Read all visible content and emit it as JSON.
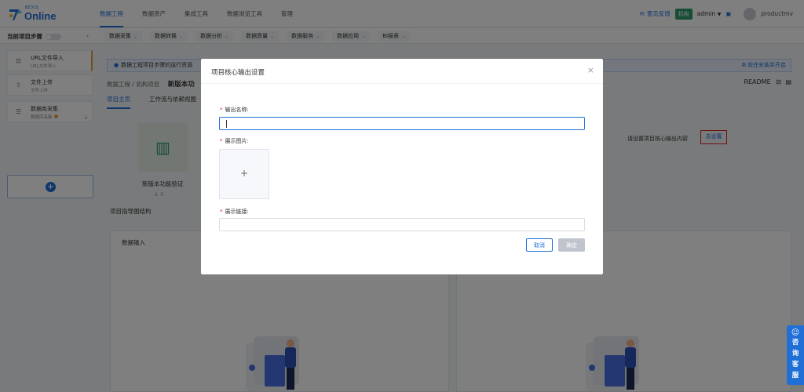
{
  "brand": {
    "small": "BEXIS",
    "name": "Online"
  },
  "nav": [
    "数据工程",
    "数据资产",
    "集成工具",
    "数据浏览工具",
    "管理"
  ],
  "topright": {
    "feedback": "意见反馈",
    "org_tag": "机构",
    "user": "admin",
    "account": "productmv"
  },
  "subbar": {
    "current_step": "当前项目步骤"
  },
  "subnav": [
    "数据采集",
    "数据转换",
    "数据分析",
    "数据质量",
    "数据服务",
    "数据应用",
    "BI报表"
  ],
  "sidebar": [
    {
      "title": "URL文件导入",
      "sub": "URL文件导入"
    },
    {
      "title": "文件上传",
      "sub": "文件上传"
    },
    {
      "title": "数据库采集",
      "sub": "数据库采集"
    }
  ],
  "notice": {
    "text": "数据工程项目步骤的运行资源",
    "link": "前往安装并开启"
  },
  "breadcrumb": {
    "p1": "数据工程",
    "sep": "/",
    "p2": "机构项目",
    "current": "新版本功"
  },
  "readme": "README",
  "tabs": [
    "项目主页",
    "工作流与依赖视图"
  ],
  "project": {
    "name": "新版本功能验证",
    "count": "3"
  },
  "settings": {
    "hint": "请设置项目核心输出内容",
    "link": "去设置"
  },
  "guide_title": "项目指导图结构",
  "flow": {
    "label": "数据输入"
  },
  "chat": {
    "chars": [
      "咨",
      "询",
      "客",
      "服"
    ]
  },
  "modal": {
    "title": "项目核心输出设置",
    "name_label": "输出名称:",
    "image_label": "展示图片:",
    "link_label": "展示链接:",
    "cancel": "取消",
    "confirm": "确定",
    "required": "*",
    "plus": "+"
  },
  "colors": {
    "primary": "#1f6fd6",
    "org_tag": "#2c9b6a",
    "highlight": "#e02020"
  }
}
